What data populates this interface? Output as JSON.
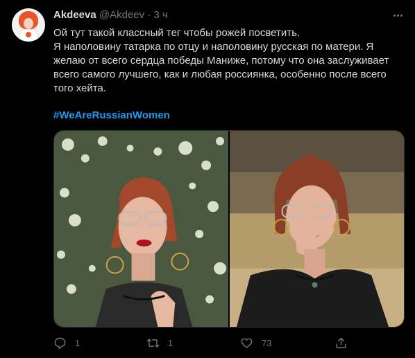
{
  "tweet": {
    "author_name": "Akdeeva",
    "author_handle": "@Akdeev",
    "separator": "·",
    "time": "3 ч",
    "text_lines": [
      "Ой тут такой классный тег чтобы рожей посветить.",
      "Я наполовину татарка по отцу и наполовину русская по матери. Я желаю от всего сердца победы Маниже, потому что она заслуживает всего самого лучшего, как и любая россиянка, особенно после всего того хейта."
    ],
    "hashtag": "#WeAreRussianWomen",
    "media": [
      {
        "description_icon": "photo-woman-blossom"
      },
      {
        "description_icon": "photo-woman-gesture"
      }
    ],
    "actions": {
      "reply_count": "1",
      "retweet_count": "1",
      "like_count": "73"
    }
  },
  "colors": {
    "background": "#000000",
    "text": "#d9d9d9",
    "muted": "#6e767d",
    "link": "#1d9bf0"
  }
}
